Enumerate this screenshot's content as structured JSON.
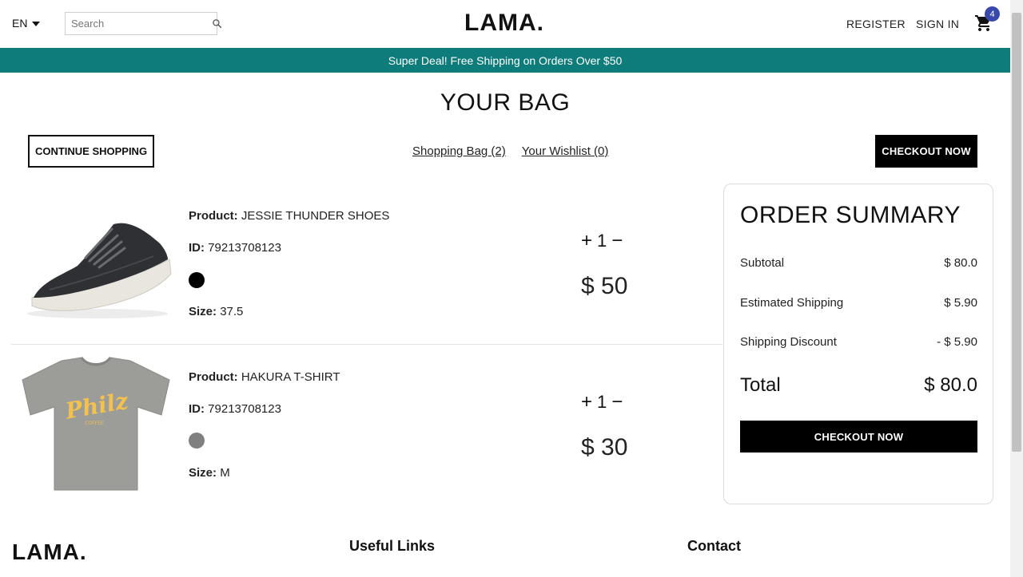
{
  "navbar": {
    "language": "EN",
    "search_placeholder": "Search",
    "logo": "LAMA.",
    "register": "REGISTER",
    "sign_in": "SIGN IN",
    "cart_count": "4"
  },
  "announcement": "Super Deal! Free Shipping on Orders Over $50",
  "page_title": "YOUR BAG",
  "top": {
    "continue_label": "CONTINUE SHOPPING",
    "bag_link": "Shopping Bag (2)",
    "wishlist_link": "Your Wishlist (0)",
    "checkout_label": "CHECKOUT NOW"
  },
  "labels": {
    "product": "Product:",
    "id": "ID:",
    "size": "Size:"
  },
  "products": [
    {
      "name": "JESSIE THUNDER SHOES",
      "id": "79213708123",
      "color": "#000000",
      "size": "37.5",
      "quantity": "1",
      "price": "$ 50"
    },
    {
      "name": "HAKURA T-SHIRT",
      "id": "79213708123",
      "color": "#808080",
      "size": "M",
      "quantity": "1",
      "price": "$ 30"
    }
  ],
  "summary": {
    "title": "ORDER SUMMARY",
    "subtotal_label": "Subtotal",
    "subtotal": "$ 80.0",
    "shipping_label": "Estimated Shipping",
    "shipping": "$ 5.90",
    "discount_label": "Shipping Discount",
    "discount": "- $ 5.90",
    "total_label": "Total",
    "total": "$ 80.0",
    "checkout_label": "CHECKOUT NOW"
  },
  "footer": {
    "logo": "LAMA.",
    "useful_links": "Useful Links",
    "contact": "Contact"
  },
  "colors": {
    "announcement_bg": "#0e7c7b",
    "badge": "#3949ab"
  }
}
